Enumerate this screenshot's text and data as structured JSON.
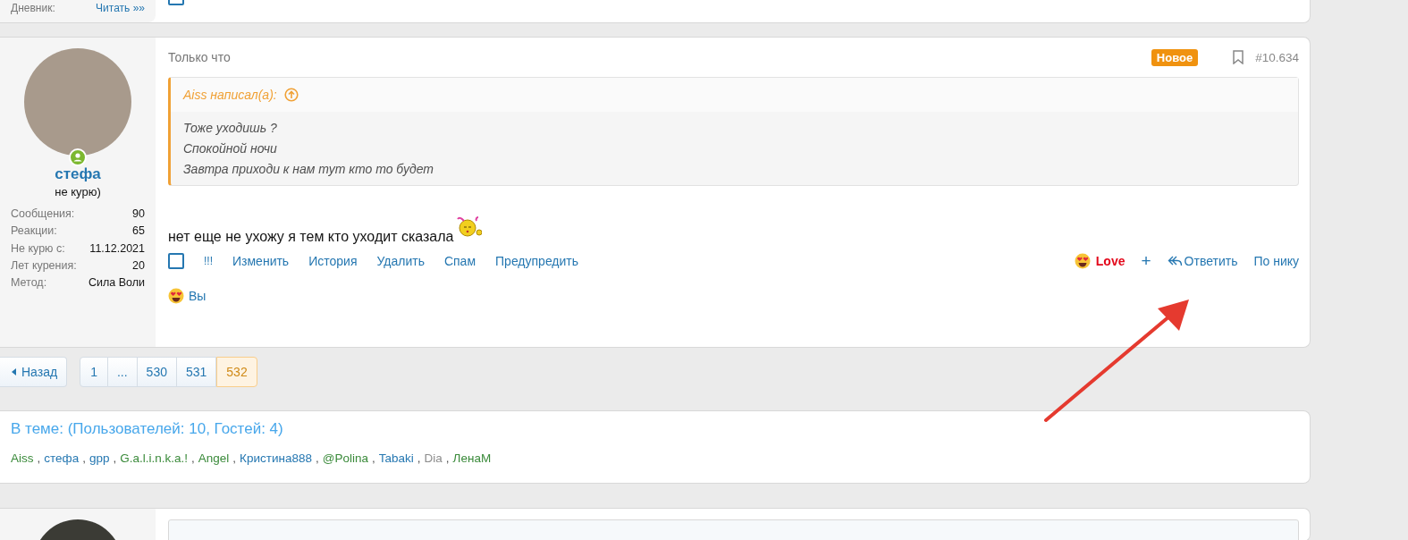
{
  "prev_post": {
    "stat_label": "Дневник:",
    "stat_link": "Читать »»",
    "checked": false
  },
  "post": {
    "author": {
      "name": "стефа",
      "title": "не курю)",
      "online": true,
      "stats": [
        {
          "label": "Сообщения:",
          "value": "90"
        },
        {
          "label": "Реакции:",
          "value": "65"
        },
        {
          "label": "Не курю с:",
          "value": "11.12.2021"
        },
        {
          "label": "Лет курения:",
          "value": "20"
        },
        {
          "label": "Метод:",
          "value": "Сила Воли"
        }
      ]
    },
    "time": "Только что",
    "badge": "Новое",
    "bookmarked": false,
    "number": "#10.634",
    "quote": {
      "author": "Aiss написал(а):",
      "lines": [
        "Тоже уходишь ?",
        "Спокойной ночи",
        "Завтра приходи к нам тут кто то будет"
      ]
    },
    "text": "нет еще не ухожу я тем кто уходит сказала",
    "checked": false,
    "actions_left": [
      "!!!",
      "Изменить",
      "История",
      "Удалить",
      "Спам",
      "Предупредить"
    ],
    "reaction": {
      "label": "Love",
      "selected": true
    },
    "add": "+",
    "reply": "Ответить",
    "by_nick": "По нику",
    "reacted_by": "Вы"
  },
  "pagination": {
    "prev": "Назад",
    "pages": [
      {
        "label": "1",
        "selected": false
      },
      {
        "label": "...",
        "selected": false
      },
      {
        "label": "530",
        "selected": false
      },
      {
        "label": "531",
        "selected": false
      },
      {
        "label": "532",
        "selected": true
      }
    ]
  },
  "online": {
    "title": "В теме: (Пользователей: 10, Гостей: 4)",
    "users": [
      {
        "name": "Aiss",
        "color": "#3a8a3a",
        "separator": ","
      },
      {
        "name": "стефа",
        "color": "#2577b1",
        "separator": ","
      },
      {
        "name": "gpp",
        "color": "#2577b1",
        "separator": ","
      },
      {
        "name": "G.a.l.i.n.k.a.!",
        "color": "#3a8a3a",
        "separator": ","
      },
      {
        "name": "Angel",
        "color": "#3a8a3a",
        "separator": ","
      },
      {
        "name": "Кристина888",
        "color": "#2577b1",
        "separator": ","
      },
      {
        "name": "@Polina",
        "color": "#3a8a3a",
        "separator": ","
      },
      {
        "name": "Tabaki",
        "color": "#2577b1",
        "separator": ","
      },
      {
        "name": "Dia",
        "color": "#8c8c8c",
        "separator": ","
      },
      {
        "name": "ЛенаМ",
        "color": "#3a8a3a"
      }
    ]
  }
}
